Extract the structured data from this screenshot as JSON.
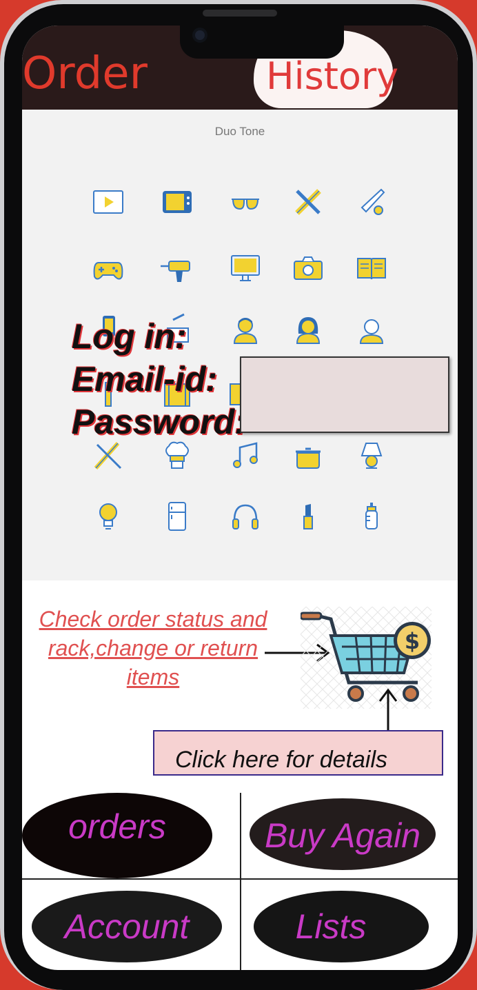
{
  "header": {
    "title_left": "Order",
    "title_right": "History"
  },
  "icons_panel": {
    "caption": "Duo Tone"
  },
  "login": {
    "line1": "Log in:",
    "line2": "Email-id:",
    "line3": "Password:"
  },
  "order_status": {
    "text": "Check order status and rack,change or return items"
  },
  "details": {
    "label": "Click here for details"
  },
  "tiles": {
    "orders": "orders",
    "buy_again": "Buy Again",
    "account": "Account",
    "lists": "Lists"
  },
  "colors": {
    "header": "#2a1a1a",
    "accent_red": "#e03a2c",
    "tile_text": "#c93ac6",
    "field_bg": "#e8dcdc",
    "details_bg": "#f6d2d2"
  }
}
